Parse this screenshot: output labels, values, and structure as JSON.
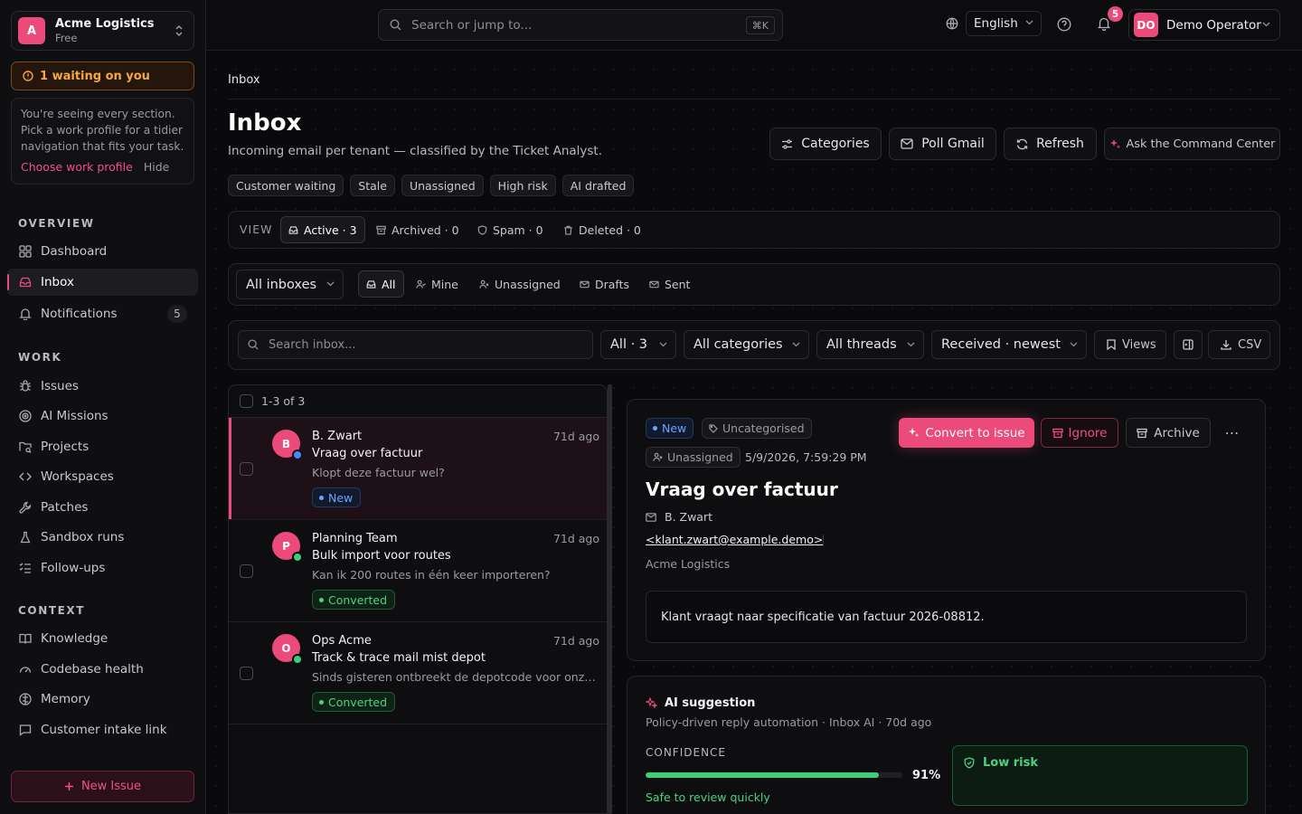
{
  "org": {
    "initial": "A",
    "name": "Acme Logistics",
    "plan": "Free"
  },
  "waiting": "1 waiting on you",
  "profile_card": {
    "text": "You're seeing every section. Pick a work profile for a tidier navigation that fits your task.",
    "choose": "Choose work profile",
    "hide": "Hide"
  },
  "sections": {
    "overview": "OVERVIEW",
    "work": "WORK",
    "context": "CONTEXT"
  },
  "nav": {
    "dashboard": "Dashboard",
    "inbox": "Inbox",
    "notifications": "Notifications",
    "notifications_count": "5",
    "issues": "Issues",
    "ai_missions": "AI Missions",
    "projects": "Projects",
    "workspaces": "Workspaces",
    "patches": "Patches",
    "sandbox_runs": "Sandbox runs",
    "follow_ups": "Follow-ups",
    "knowledge": "Knowledge",
    "codebase_health": "Codebase health",
    "memory": "Memory",
    "customer_intake": "Customer intake link"
  },
  "new_issue": "New Issue",
  "topbar": {
    "search_placeholder": "Search or jump to...",
    "shortcut": "⌘K",
    "language": "English",
    "notif_badge": "5",
    "user_initials": "DO",
    "user_name": "Demo Operator"
  },
  "breadcrumb": "Inbox",
  "page": {
    "title": "Inbox",
    "subtitle": "Incoming email per tenant — classified by the Ticket Analyst."
  },
  "actions": {
    "categories": "Categories",
    "poll_gmail": "Poll Gmail",
    "refresh": "Refresh",
    "ask": "Ask the Command Center"
  },
  "chips": [
    "Customer waiting",
    "Stale",
    "Unassigned",
    "High risk",
    "AI drafted"
  ],
  "view": {
    "label": "VIEW",
    "active": "Active · 3",
    "archived": "Archived · 0",
    "spam": "Spam · 0",
    "deleted": "Deleted · 0"
  },
  "filters": {
    "inboxes": "All inboxes",
    "all": "All",
    "mine": "Mine",
    "unassigned": "Unassigned",
    "drafts": "Drafts",
    "sent": "Sent"
  },
  "toolbar": {
    "search_placeholder": "Search inbox...",
    "count": "All · 3",
    "categories": "All categories",
    "threads": "All threads",
    "sort": "Received · newest",
    "views": "Views",
    "csv": "CSV"
  },
  "list": {
    "count": "1-3 of 3",
    "items": [
      {
        "initial": "B",
        "name": "B. Zwart",
        "time": "71d ago",
        "subject": "Vraag over factuur",
        "preview": "Klopt deze factuur wel?",
        "badge": "New",
        "dot_color": "#4a86ff"
      },
      {
        "initial": "P",
        "name": "Planning Team",
        "time": "71d ago",
        "subject": "Bulk import voor routes",
        "preview": "Kan ik 200 routes in één keer importeren?",
        "badge": "Converted",
        "dot_color": "#3ccf78"
      },
      {
        "initial": "O",
        "name": "Ops Acme",
        "time": "71d ago",
        "subject": "Track & trace mail mist depot",
        "preview": "Sinds gisteren ontbreekt de depotcode voor onze ...",
        "badge": "Converted",
        "dot_color": "#3ccf78"
      }
    ]
  },
  "detail": {
    "status": "New",
    "category": "Uncategorised",
    "assignee": "Unassigned",
    "received": "5/9/2026, 7:59:29 PM",
    "convert": "Convert to issue",
    "ignore": "Ignore",
    "archive": "Archive",
    "title": "Vraag over factuur",
    "from": "B. Zwart",
    "email": "<klant.zwart@example.demo>",
    "org": "Acme Logistics",
    "body": "Klant vraagt naar specificatie van factuur 2026-08812."
  },
  "ai": {
    "title": "AI suggestion",
    "subtitle": "Policy-driven reply automation · Inbox AI · 70d ago",
    "confidence_label": "CONFIDENCE",
    "confidence": 0.91,
    "confidence_text": "91%",
    "safe": "Safe to review quickly",
    "risk": "Low risk"
  },
  "colors": {
    "accent": "#ec4a7b",
    "success": "#3ccf78",
    "info": "#6ea2ff",
    "warning": "#f5a83c"
  }
}
